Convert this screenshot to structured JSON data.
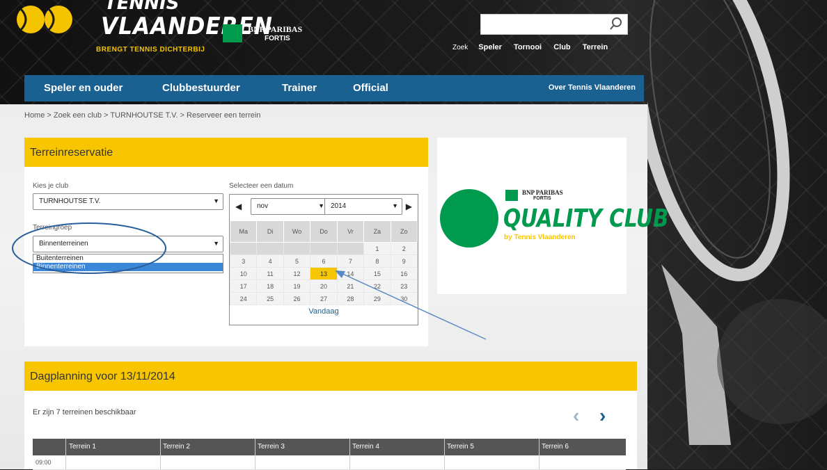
{
  "brand": {
    "title_top": "TENNIS",
    "title": "VLAANDEREN",
    "tagline": "BRENGT TENNIS DICHTERBIJ",
    "sponsor_line1": "BNP PARIBAS",
    "sponsor_line2": "FORTIS"
  },
  "header": {
    "search_placeholder": "",
    "links": [
      "Zoek",
      "Speler",
      "Tornooi",
      "Club",
      "Terrein"
    ]
  },
  "nav": {
    "items": [
      "Speler en ouder",
      "Clubbestuurder",
      "Trainer",
      "Official"
    ],
    "right": "Over Tennis Vlaanderen"
  },
  "breadcrumb": "Home > Zoek een club > TURNHOUTSE T.V. > Reserveer een terrein",
  "reservation": {
    "title": "Terreinreservatie",
    "club_label": "Kies je club",
    "club_value": "TURNHOUTSE T.V.",
    "group_label": "Terreingroep",
    "group_value": "Binnenterreinen",
    "group_options": [
      "Buitenterreinen",
      "Binnenterreinen"
    ],
    "date_label": "Selecteer een datum",
    "month": "nov",
    "year": "2014",
    "weekdays": [
      "Ma",
      "Di",
      "Wo",
      "Do",
      "Vr",
      "Za",
      "Zo"
    ],
    "weeks": [
      [
        "",
        "",
        "",
        "",
        "",
        "1",
        "2"
      ],
      [
        "3",
        "4",
        "5",
        "6",
        "7",
        "8",
        "9"
      ],
      [
        "10",
        "11",
        "12",
        "13",
        "14",
        "15",
        "16"
      ],
      [
        "17",
        "18",
        "19",
        "20",
        "21",
        "22",
        "23"
      ],
      [
        "24",
        "25",
        "26",
        "27",
        "28",
        "29",
        "30"
      ]
    ],
    "selected_day": "13",
    "today_label": "Vandaag"
  },
  "ad": {
    "sponsor_line1": "BNP PARIBAS",
    "sponsor_line2": "FORTIS",
    "title": "QUALITY CLUB",
    "subtitle": "by Tennis Vlaanderen"
  },
  "schedule": {
    "title": "Dagplanning voor 13/11/2014",
    "available": "Er zijn 7 terreinen beschikbaar",
    "columns": [
      "Terrein 1",
      "Terrein 2",
      "Terrein 3",
      "Terrein 4",
      "Terrein 5",
      "Terrein 6"
    ],
    "first_time": "09:00"
  },
  "colors": {
    "accent_yellow": "#f7c600",
    "nav_blue": "#1a6090",
    "green": "#009a4e"
  }
}
